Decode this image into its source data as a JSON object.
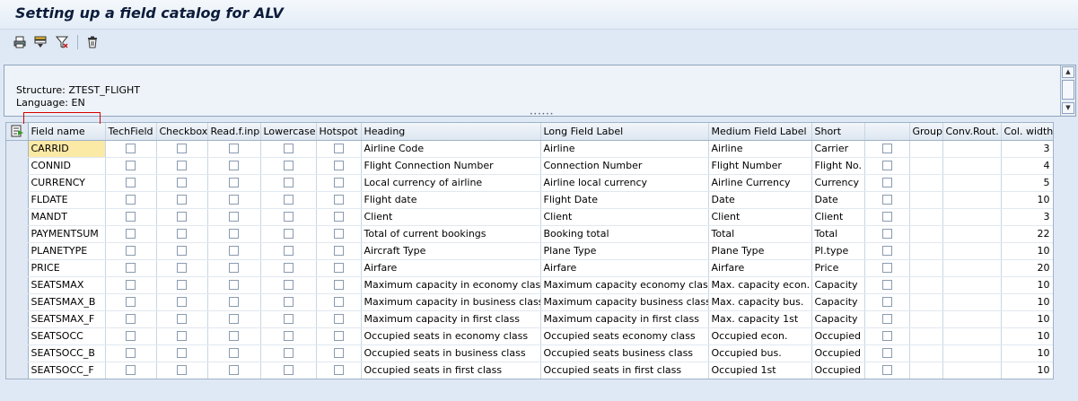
{
  "window": {
    "title": "Setting up a field catalog for ALV"
  },
  "toolbar": {
    "buttons": [
      {
        "name": "print-icon"
      },
      {
        "name": "layout-icon"
      },
      {
        "name": "filter-icon"
      },
      {
        "name": "delete-icon"
      }
    ]
  },
  "header": {
    "structure": "Structure: ZTEST_FLIGHT",
    "language": "Language: EN"
  },
  "grid": {
    "columns": [
      "Field name",
      "TechField",
      "Checkbox",
      "Read.f.inp",
      "Lowercase",
      "Hotspot",
      "Heading",
      "Long Field Label",
      "Medium Field Label",
      "Short",
      "",
      "Group",
      "Conv.Rout.",
      "Col. width"
    ],
    "rows": [
      {
        "field": "CARRID",
        "heading": "Airline Code",
        "long": "Airline",
        "medium": "Airline",
        "short": "Carrier",
        "width": "3"
      },
      {
        "field": "CONNID",
        "heading": "Flight Connection Number",
        "long": "Connection Number",
        "medium": "Flight Number",
        "short": "Flight No.",
        "width": "4"
      },
      {
        "field": "CURRENCY",
        "heading": "Local currency of airline",
        "long": "Airline local currency",
        "medium": "Airline Currency",
        "short": "Currency",
        "width": "5"
      },
      {
        "field": "FLDATE",
        "heading": "Flight date",
        "long": "Flight Date",
        "medium": "Date",
        "short": "Date",
        "width": "10"
      },
      {
        "field": "MANDT",
        "heading": "Client",
        "long": "Client",
        "medium": "Client",
        "short": "Client",
        "width": "3"
      },
      {
        "field": "PAYMENTSUM",
        "heading": "Total of current bookings",
        "long": "Booking total",
        "medium": "Total",
        "short": "Total",
        "width": "22"
      },
      {
        "field": "PLANETYPE",
        "heading": "Aircraft Type",
        "long": "Plane Type",
        "medium": "Plane Type",
        "short": "Pl.type",
        "width": "10"
      },
      {
        "field": "PRICE",
        "heading": "Airfare",
        "long": "Airfare",
        "medium": "Airfare",
        "short": "Price",
        "width": "20"
      },
      {
        "field": "SEATSMAX",
        "heading": "Maximum capacity in economy class",
        "long": "Maximum capacity economy class",
        "medium": "Max. capacity econ.",
        "short": "Capacity",
        "width": "10"
      },
      {
        "field": "SEATSMAX_B",
        "heading": "Maximum capacity in business class",
        "long": "Maximum capacity business class",
        "medium": "Max. capacity bus.",
        "short": "Capacity",
        "width": "10"
      },
      {
        "field": "SEATSMAX_F",
        "heading": "Maximum capacity in first class",
        "long": "Maximum capacity in first class",
        "medium": "Max. capacity 1st",
        "short": "Capacity",
        "width": "10"
      },
      {
        "field": "SEATSOCC",
        "heading": "Occupied seats in economy class",
        "long": "Occupied seats economy class",
        "medium": "Occupied econ.",
        "short": "Occupied",
        "width": "10"
      },
      {
        "field": "SEATSOCC_B",
        "heading": "Occupied seats in business class",
        "long": "Occupied seats business class",
        "medium": "Occupied bus.",
        "short": "Occupied",
        "width": "10"
      },
      {
        "field": "SEATSOCC_F",
        "heading": "Occupied seats in first class",
        "long": "Occupied seats in first class",
        "medium": "Occupied 1st",
        "short": "Occupied",
        "width": "10"
      }
    ]
  },
  "colors": {
    "background": "#dfe9f5",
    "focus_cell": "#fbe9a6",
    "title_text": "#0c1c3a",
    "marker": "#d40000"
  }
}
